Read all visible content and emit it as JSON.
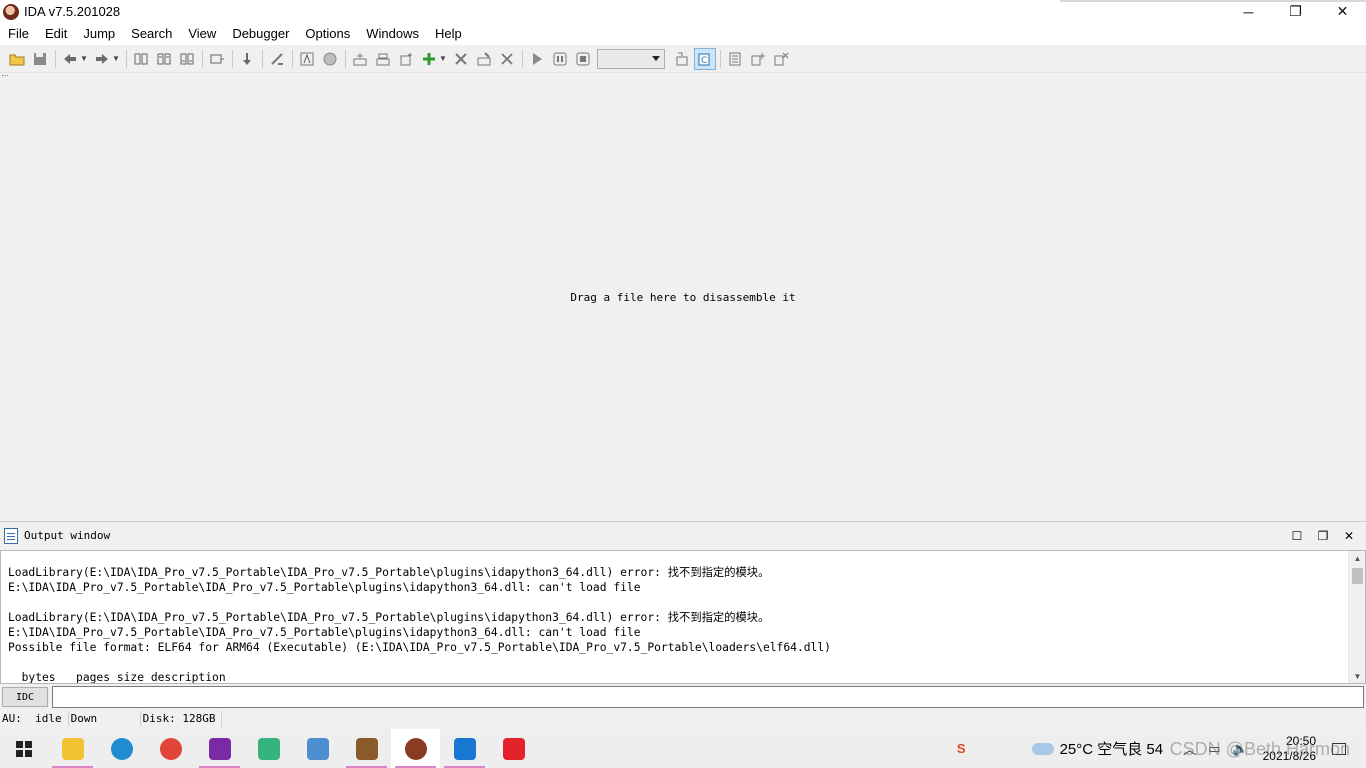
{
  "window": {
    "title": "IDA v7.5.201028",
    "minimize": "─",
    "restore": "❐",
    "close": "✕"
  },
  "menu": [
    "File",
    "Edit",
    "Jump",
    "Search",
    "View",
    "Debugger",
    "Options",
    "Windows",
    "Help"
  ],
  "main": {
    "hint": "Drag a file here to disassemble it"
  },
  "output": {
    "title": "Output window",
    "lines": [
      "LoadLibrary(E:\\IDA\\IDA_Pro_v7.5_Portable\\IDA_Pro_v7.5_Portable\\plugins\\idapython3_64.dll) error: 找不到指定的模块。",
      "E:\\IDA\\IDA_Pro_v7.5_Portable\\IDA_Pro_v7.5_Portable\\plugins\\idapython3_64.dll: can't load file",
      "",
      "LoadLibrary(E:\\IDA\\IDA_Pro_v7.5_Portable\\IDA_Pro_v7.5_Portable\\plugins\\idapython3_64.dll) error: 找不到指定的模块。",
      "E:\\IDA\\IDA_Pro_v7.5_Portable\\IDA_Pro_v7.5_Portable\\plugins\\idapython3_64.dll: can't load file",
      "Possible file format: ELF64 for ARM64 (Executable) (E:\\IDA\\IDA_Pro_v7.5_Portable\\IDA_Pro_v7.5_Portable\\loaders\\elf64.dll)",
      "",
      "  bytes   pages size description"
    ],
    "cmd_button": "IDC"
  },
  "status": {
    "au_label": "AU:",
    "au_value": "idle",
    "direction": "Down",
    "disk": "Disk: 128GB"
  },
  "taskbar": {
    "apps": [
      {
        "name": "file-explorer",
        "color": "#f2c230",
        "running": true
      },
      {
        "name": "edge",
        "color": "#1f8bd0",
        "running": false
      },
      {
        "name": "chrome",
        "color": "#e3443a",
        "running": false
      },
      {
        "name": "onenote",
        "color": "#7b2aa6",
        "running": true
      },
      {
        "name": "unknown-app",
        "color": "#36b37e",
        "running": false
      },
      {
        "name": "control-panel",
        "color": "#4e8fd1",
        "running": false
      },
      {
        "name": "winrar",
        "color": "#8b5a2b",
        "running": true
      },
      {
        "name": "ida",
        "color": "#8a3b22",
        "running": true
      },
      {
        "name": "phone-link",
        "color": "#1977d2",
        "running": true
      },
      {
        "name": "youdao",
        "color": "#e3222b",
        "running": false
      }
    ],
    "weather": "25°C 空气良 54",
    "time": "20:50",
    "date": "2021/8/26",
    "ime_icon": "S"
  },
  "watermark": "CSDN @Beth Harmon"
}
